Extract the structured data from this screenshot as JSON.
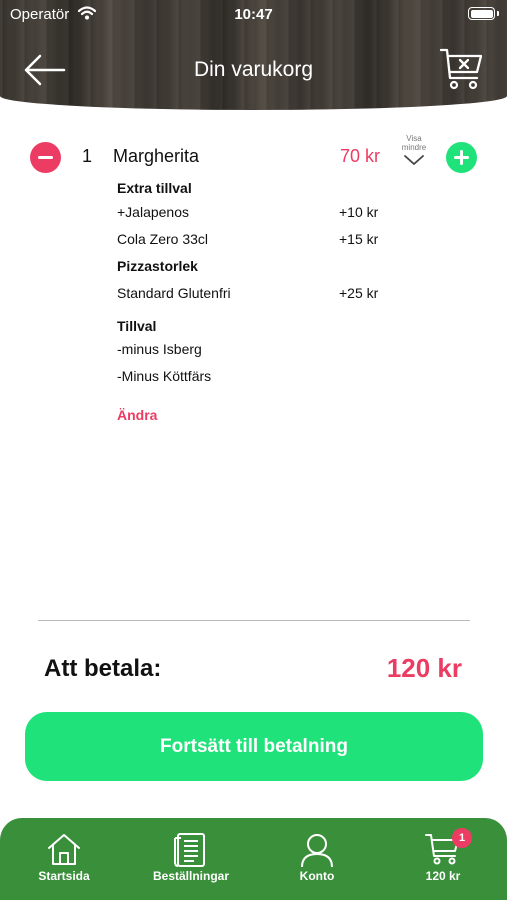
{
  "status_bar": {
    "carrier": "Operatör",
    "time": "10:47"
  },
  "header": {
    "title": "Din varukorg"
  },
  "item": {
    "quantity": "1",
    "name": "Margherita",
    "price": "70 kr",
    "toggle_label_1": "Visa",
    "toggle_label_2": "mindre"
  },
  "details": {
    "extra_heading": "Extra tillval",
    "extras": [
      {
        "name": "+Jalapenos",
        "price": "+10 kr"
      },
      {
        "name": "Cola Zero 33cl",
        "price": "+15 kr"
      }
    ],
    "size_heading": "Pizzastorlek",
    "size": {
      "name": "Standard Glutenfri",
      "price": "+25 kr"
    },
    "options_heading": "Tillval",
    "options": [
      "-minus Isberg",
      "-Minus Köttfärs"
    ],
    "edit_label": "Ändra"
  },
  "summary": {
    "total_label": "Att betala:",
    "total_value": "120 kr"
  },
  "checkout": {
    "label": "Fortsätt till betalning"
  },
  "tab_bar": {
    "tabs": [
      {
        "label": "Startsida",
        "icon": "house-icon"
      },
      {
        "label": "Beställningar",
        "icon": "receipt-icon"
      },
      {
        "label": "Konto",
        "icon": "user-icon"
      },
      {
        "label": "120 kr",
        "icon": "cart-icon",
        "badge": "1"
      }
    ]
  },
  "colors": {
    "accent_red": "#ec3c63",
    "accent_green": "#1fe27a",
    "tab_green": "#3a8f3b"
  }
}
